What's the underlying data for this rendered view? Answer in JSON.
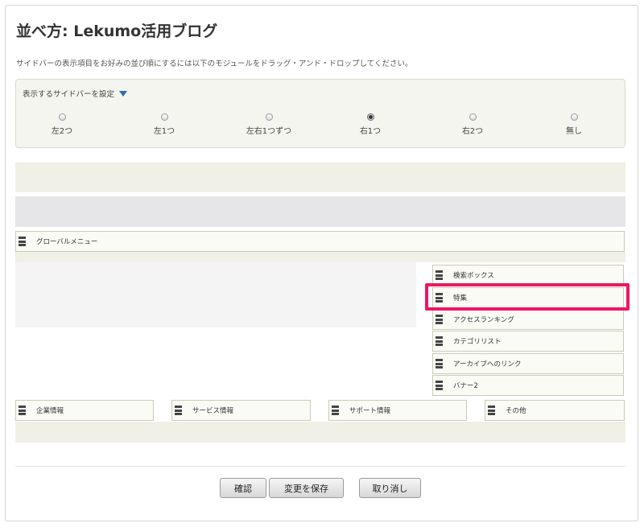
{
  "page": {
    "title": "並べ方: Lekumo活用ブログ",
    "description": "サイドバーの表示項目をお好みの並び順にするには以下のモジュールをドラッグ・アンド・ドロップしてください。"
  },
  "sidebar_setting": {
    "label": "表示するサイドバーを設定",
    "options": [
      {
        "label": "左2つ",
        "selected": false
      },
      {
        "label": "左1つ",
        "selected": false
      },
      {
        "label": "左右1つずつ",
        "selected": false
      },
      {
        "label": "右1つ",
        "selected": true
      },
      {
        "label": "右2つ",
        "selected": false
      },
      {
        "label": "無し",
        "selected": false
      }
    ]
  },
  "modules": {
    "global_menu": "グローバルメニュー",
    "sidebar": [
      "検索ボックス",
      "特集",
      "アクセスランキング",
      "カテゴリリスト",
      "アーカイブへのリンク",
      "バナー2"
    ],
    "footer": [
      "企業情報",
      "サービス情報",
      "サポート情報",
      "その他"
    ]
  },
  "highlight": {
    "color": "#ee1763"
  },
  "buttons": {
    "confirm": "確認",
    "save": "変更を保存",
    "cancel": "取り消し"
  }
}
